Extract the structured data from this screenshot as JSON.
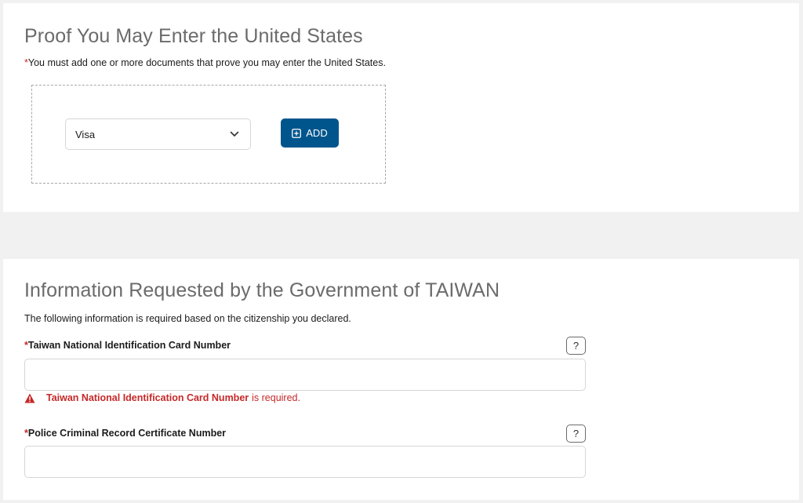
{
  "proof_section": {
    "title": "Proof You May Enter the United States",
    "required_marker": "*",
    "intro": "You must add one or more documents that prove you may enter the United States.",
    "document_select": {
      "selected": "Visa",
      "icon": "chevron-down-icon"
    },
    "add_button": {
      "label": "ADD",
      "icon": "plus-square-icon"
    }
  },
  "taiwan_section": {
    "title": "Information Requested by the Government of TAIWAN",
    "intro": "The following information is required based on the citizenship you declared.",
    "fields": [
      {
        "required_marker": "*",
        "label": "Taiwan National Identification Card Number",
        "help": "?",
        "value": "",
        "error": {
          "field_name": "Taiwan National Identification Card Number",
          "message": "is required.",
          "icon": "warning-icon"
        }
      },
      {
        "required_marker": "*",
        "label": "Police Criminal Record Certificate Number",
        "help": "?",
        "value": ""
      }
    ]
  },
  "colors": {
    "primary": "#00558c",
    "error": "#c62828",
    "title_gray": "#6b6b6b",
    "background": "#f1f1f1"
  }
}
